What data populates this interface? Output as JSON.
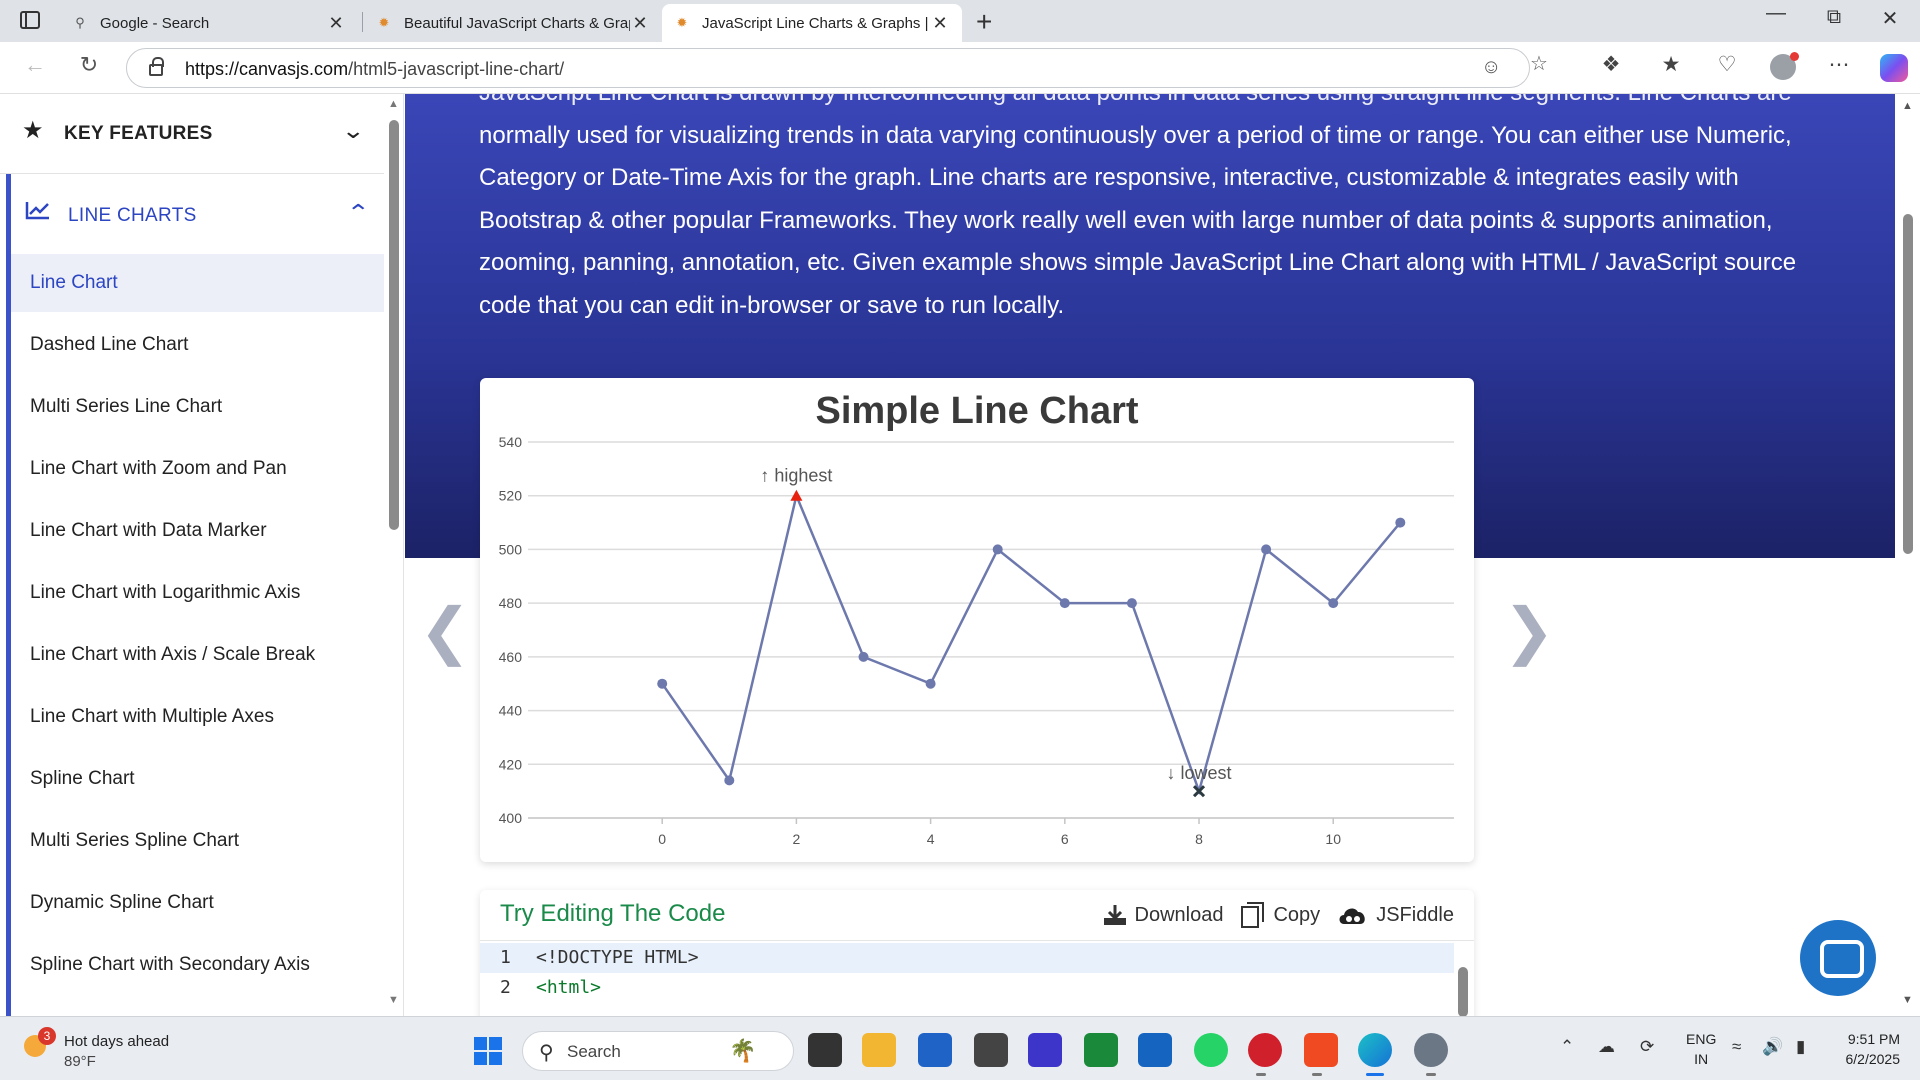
{
  "browser": {
    "tabs": [
      {
        "title": "Google - Search",
        "icon": "search-icon"
      },
      {
        "title": "Beautiful JavaScript Charts & Grap",
        "icon": "canvasjs-icon"
      },
      {
        "title": "JavaScript Line Charts & Graphs |",
        "icon": "canvasjs-icon"
      }
    ],
    "url_domain": "https://canvasjs.com",
    "url_path": "/html5-javascript-line-chart/"
  },
  "sidebar": {
    "key_features": "KEY FEATURES",
    "line_charts": "LINE CHARTS",
    "items": [
      {
        "label": "Line Chart"
      },
      {
        "label": "Dashed Line Chart"
      },
      {
        "label": "Multi Series Line Chart"
      },
      {
        "label": "Line Chart with Zoom and Pan"
      },
      {
        "label": "Line Chart with Data Marker"
      },
      {
        "label": "Line Chart with Logarithmic Axis"
      },
      {
        "label": "Line Chart with Axis / Scale Break"
      },
      {
        "label": "Line Chart with Multiple Axes"
      },
      {
        "label": "Spline Chart"
      },
      {
        "label": "Multi Series Spline Chart"
      },
      {
        "label": "Dynamic Spline Chart"
      },
      {
        "label": "Spline Chart with Secondary Axis"
      }
    ]
  },
  "hero": {
    "text_partial": "JavaScript Line Chart is drawn by interconnecting all data points in data series using straight line segments. Line Charts are",
    "text": "normally used for visualizing trends in data varying continuously over a period of time or range. You can either use Numeric, Category or Date-Time Axis for the graph. Line charts are responsive, interactive, customizable & integrates easily with Bootstrap & other popular Frameworks. They work really well even with large number of data points & supports animation, zooming, panning, annotation, etc. Given example shows simple JavaScript Line Chart along with HTML / JavaScript source code that you can edit in-browser or save to run locally."
  },
  "chart_data": {
    "type": "line",
    "title": "Simple Line Chart",
    "x": [
      0,
      1,
      2,
      3,
      4,
      5,
      6,
      7,
      8,
      9,
      10,
      11
    ],
    "values": [
      450,
      414,
      520,
      460,
      450,
      500,
      480,
      480,
      410,
      500,
      480,
      510
    ],
    "xlim": [
      -2,
      11.8
    ],
    "ylim": [
      400,
      540
    ],
    "xticks": [
      0,
      2,
      4,
      6,
      8,
      10
    ],
    "yticks": [
      400,
      420,
      440,
      460,
      480,
      500,
      520,
      540
    ],
    "grid": true,
    "color": "#6d78ad",
    "annotations": [
      {
        "x": 2,
        "label": "↑ highest",
        "marker": "triangle",
        "color": "#e8210e"
      },
      {
        "x": 8,
        "label": "↓ lowest",
        "marker": "cross",
        "color": "#2b3a40"
      }
    ]
  },
  "code": {
    "title": "Try Editing The Code",
    "download": "Download",
    "copy": "Copy",
    "jsfiddle": "JSFiddle",
    "lines": [
      {
        "n": "1",
        "src": "<!DOCTYPE HTML>"
      },
      {
        "n": "2",
        "src": "<html>"
      }
    ]
  },
  "taskbar": {
    "weather_badge": "3",
    "weather_title": "Hot days ahead",
    "weather_temp": "89°F",
    "search": "Search",
    "lang1": "ENG",
    "lang2": "IN",
    "time": "9:51 PM",
    "date": "6/2/2025"
  }
}
